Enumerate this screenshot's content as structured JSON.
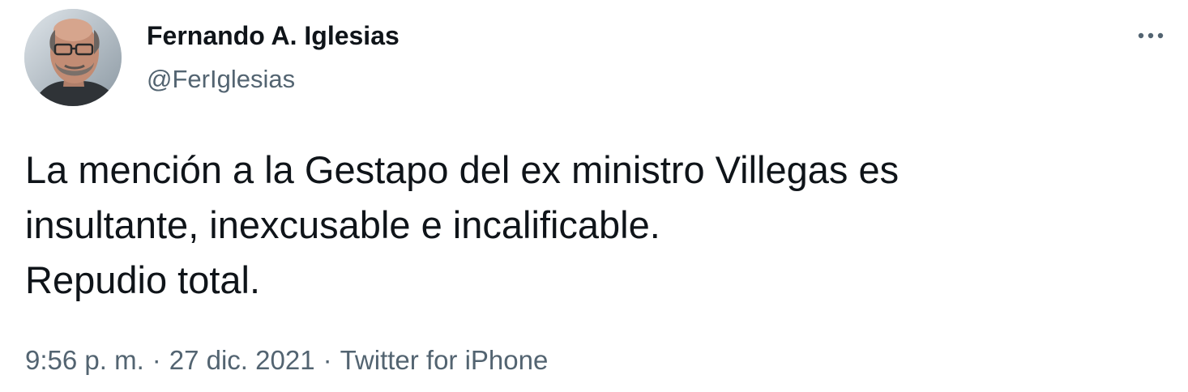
{
  "author": {
    "display_name": "Fernando A. Iglesias",
    "handle": "@FerIglesias",
    "avatar_icon": "profile-photo"
  },
  "more_icon": "more-options-icon",
  "tweet": {
    "lines": [
      "La mención a la Gestapo del ex ministro Villegas es",
      "insultante, inexcusable e incalificable.",
      "Repudio total."
    ]
  },
  "meta": {
    "time": "9:56 p. m.",
    "separator": "·",
    "date": "27 dic. 2021",
    "source": "Twitter for iPhone"
  },
  "colors": {
    "text_primary": "#0f1419",
    "text_secondary": "#536471",
    "background": "#ffffff"
  }
}
